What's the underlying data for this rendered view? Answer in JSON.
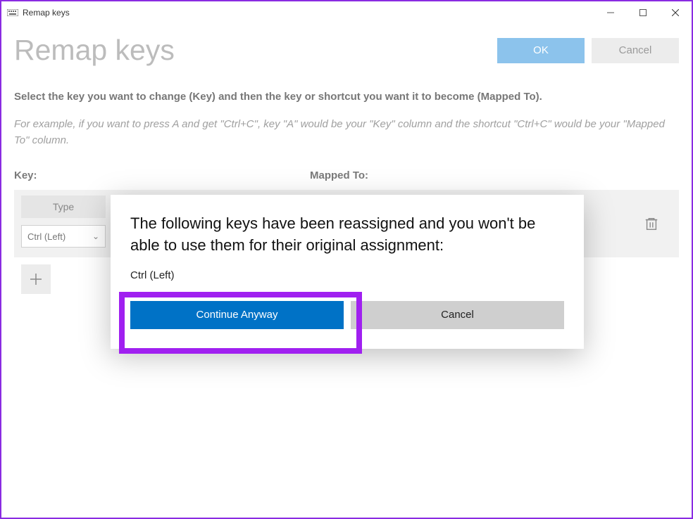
{
  "titlebar": {
    "title": "Remap keys"
  },
  "header": {
    "page_title": "Remap keys",
    "ok": "OK",
    "cancel": "Cancel"
  },
  "instructions": {
    "bold": "Select the key you want to change (Key) and then the key or shortcut you want it to become (Mapped To).",
    "italic": "For example, if you want to press A and get \"Ctrl+C\", key \"A\" would be your \"Key\" column and the shortcut \"Ctrl+C\" would be your \"Mapped To\" column."
  },
  "columns": {
    "key": "Key:",
    "mapped_to": "Mapped To:"
  },
  "row": {
    "type_label": "Type",
    "selected_key": "Ctrl (Left)"
  },
  "modal": {
    "message": "The following keys have been reassigned and you won't be able to use them for their original assignment:",
    "keys": "Ctrl (Left)",
    "continue": "Continue Anyway",
    "cancel": "Cancel"
  }
}
